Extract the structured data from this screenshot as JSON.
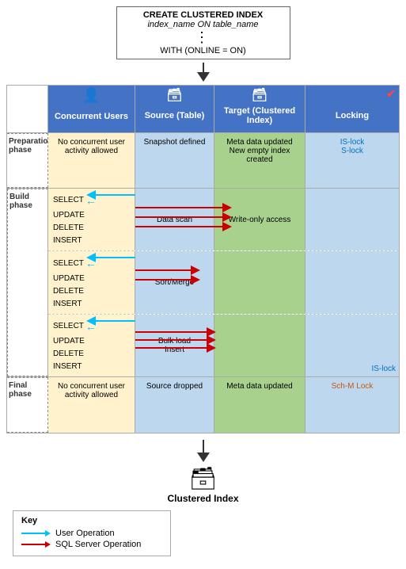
{
  "sql": {
    "line1": "CREATE CLUSTERED INDEX",
    "line2": "index_name ON table_name",
    "dots": "⋮",
    "line3": "WITH (ONLINE = ON)"
  },
  "columns": {
    "concurrent": "Concurrent Users",
    "source": "Source (Table)",
    "target": "Target (Clustered Index)",
    "locking": "Locking"
  },
  "phases": {
    "preparation": {
      "label": "Preparation phase",
      "concurrent": "No concurrent user activity allowed",
      "source": "Snapshot defined",
      "target_line1": "Meta data updated",
      "target_line2": "New empty index created",
      "lock1": "IS-lock",
      "lock2": "S-lock"
    },
    "build": {
      "label": "Build phase",
      "sub_rows": [
        {
          "ops": [
            "SELECT",
            "UPDATE",
            "DELETE",
            "INSERT"
          ],
          "source": "Data scan",
          "target": "Write-only access",
          "locking": ""
        },
        {
          "ops": [
            "SELECT",
            "UPDATE",
            "DELETE",
            "INSERT"
          ],
          "source": "Sort/Merge",
          "target": "",
          "locking": ""
        },
        {
          "ops": [
            "SELECT",
            "UPDATE",
            "DELETE",
            "INSERT"
          ],
          "source": "Bulk load\nInsert",
          "target": "",
          "locking": "IS-lock"
        }
      ]
    },
    "final": {
      "label": "Final phase",
      "concurrent": "No concurrent user activity allowed",
      "source": "Source dropped",
      "target": "Meta data updated",
      "locking": "Sch-M Lock"
    }
  },
  "key": {
    "title": "Key",
    "user_op": "User Operation",
    "sql_op": "SQL Server Operation"
  },
  "clustered_index_label": "Clustered Index",
  "icons": {
    "user": "👤",
    "database": "🗃",
    "check": "✔"
  }
}
